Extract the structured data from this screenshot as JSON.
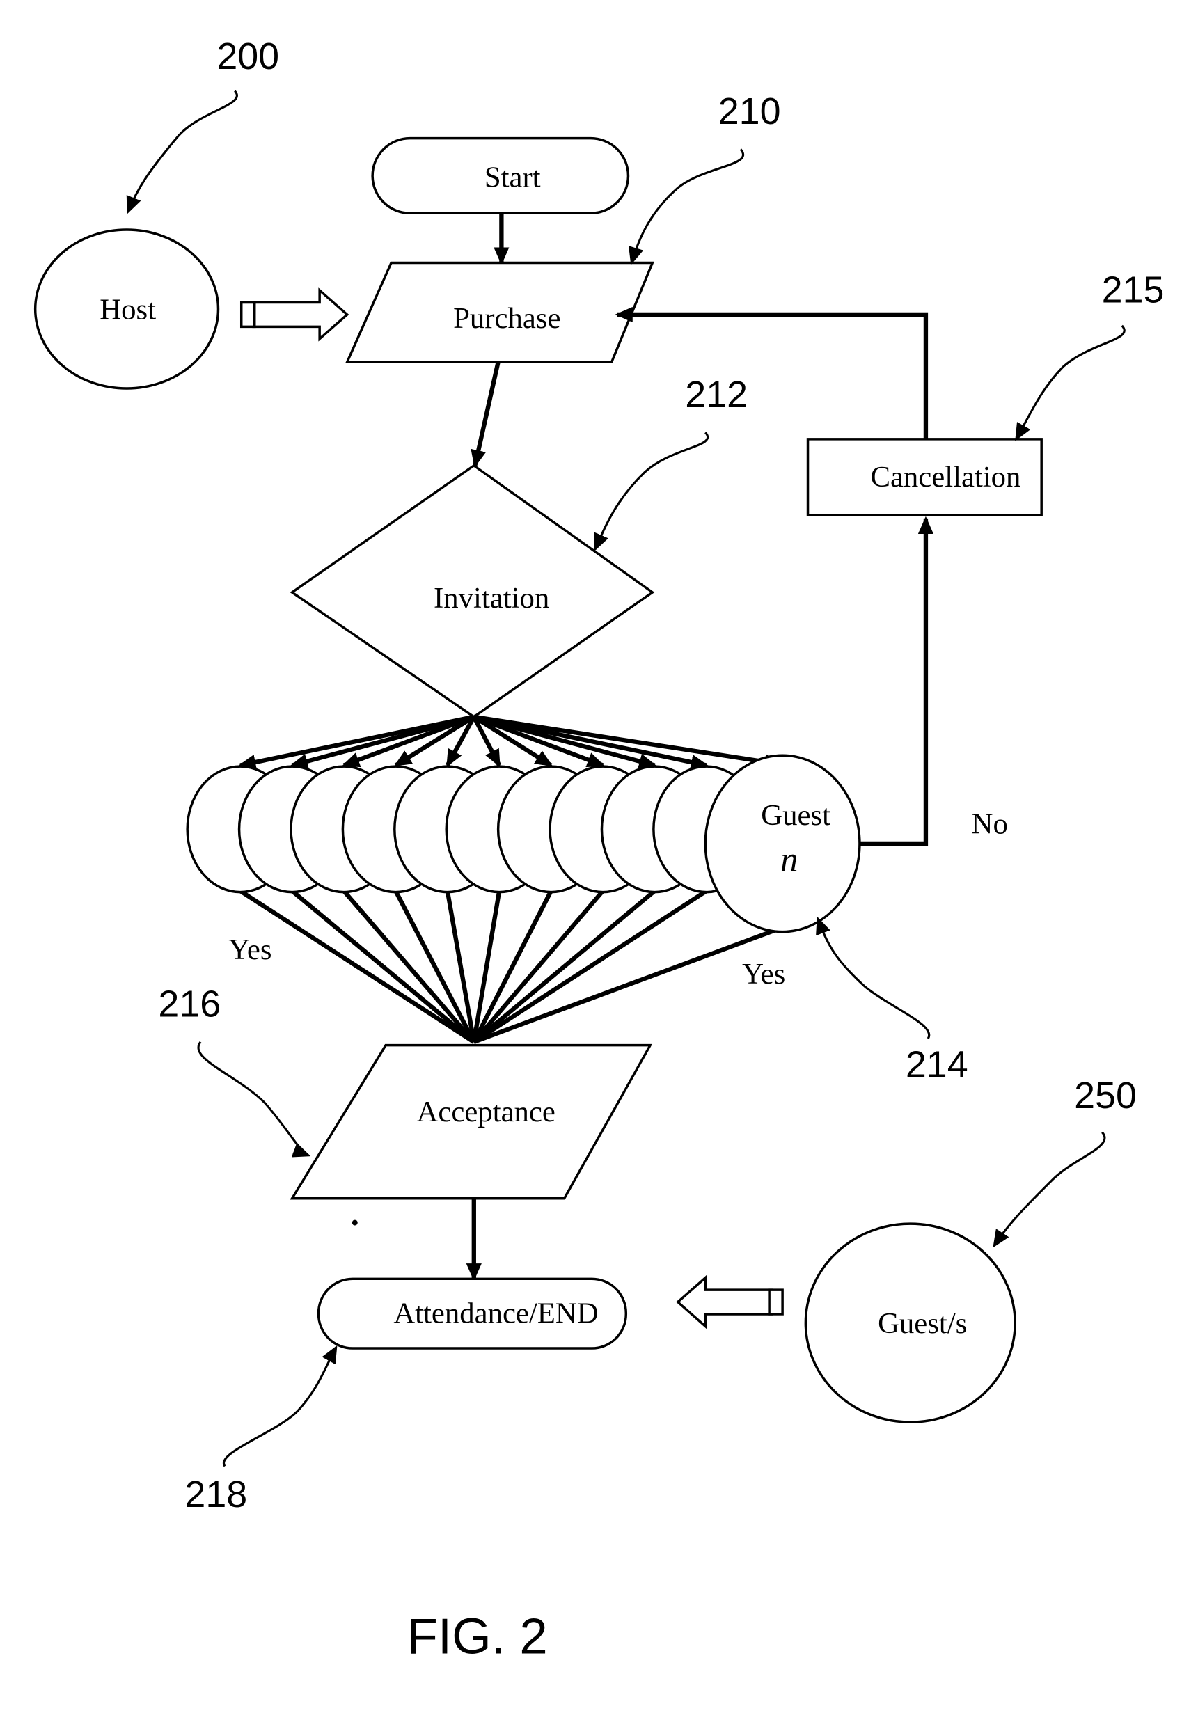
{
  "figure": {
    "caption": "FIG. 2",
    "nodes": {
      "host": {
        "label": "Host",
        "ref": "200"
      },
      "start": {
        "label": "Start"
      },
      "purchase": {
        "label": "Purchase",
        "ref": "210"
      },
      "invitation": {
        "label": "Invitation",
        "ref": "212"
      },
      "cancellation": {
        "label": "Cancellation",
        "ref": "215"
      },
      "guest_n": {
        "label": "Guest",
        "sub": "n",
        "ref": "214"
      },
      "acceptance": {
        "label": "Acceptance",
        "ref": "216"
      },
      "attendance": {
        "label": "Attendance/END",
        "ref": "218"
      },
      "guests": {
        "label": "Guest/s",
        "ref": "250"
      }
    },
    "guest_circle_count": 10,
    "edge_labels": {
      "no": "No",
      "yes_left": "Yes",
      "yes_right": "Yes"
    }
  }
}
